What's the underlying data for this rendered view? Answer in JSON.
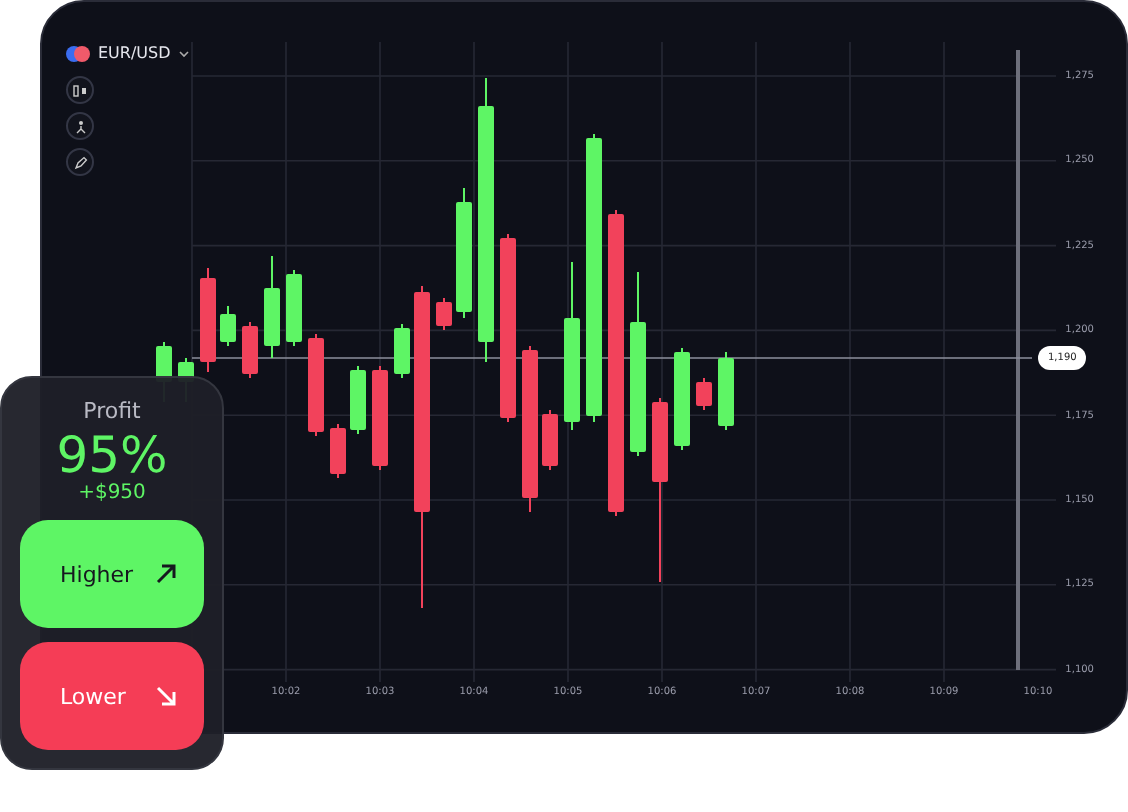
{
  "instrument": {
    "symbol": "EUR/USD"
  },
  "price_axis": [
    "1,275",
    "1,250",
    "1,225",
    "1,200",
    "1,175",
    "1,150",
    "1,125",
    "1,100"
  ],
  "current_price": "1,190",
  "time_axis": [
    "10:02",
    "10:03",
    "10:04",
    "10:05",
    "10:06",
    "10:07",
    "10:08",
    "10:09",
    "10:10"
  ],
  "trade_panel": {
    "title": "Profit",
    "payout": "95%",
    "profit": "+$950",
    "buttons": [
      {
        "label": "Higher",
        "kind": "up"
      },
      {
        "label": "Lower",
        "kind": "down"
      }
    ]
  }
}
